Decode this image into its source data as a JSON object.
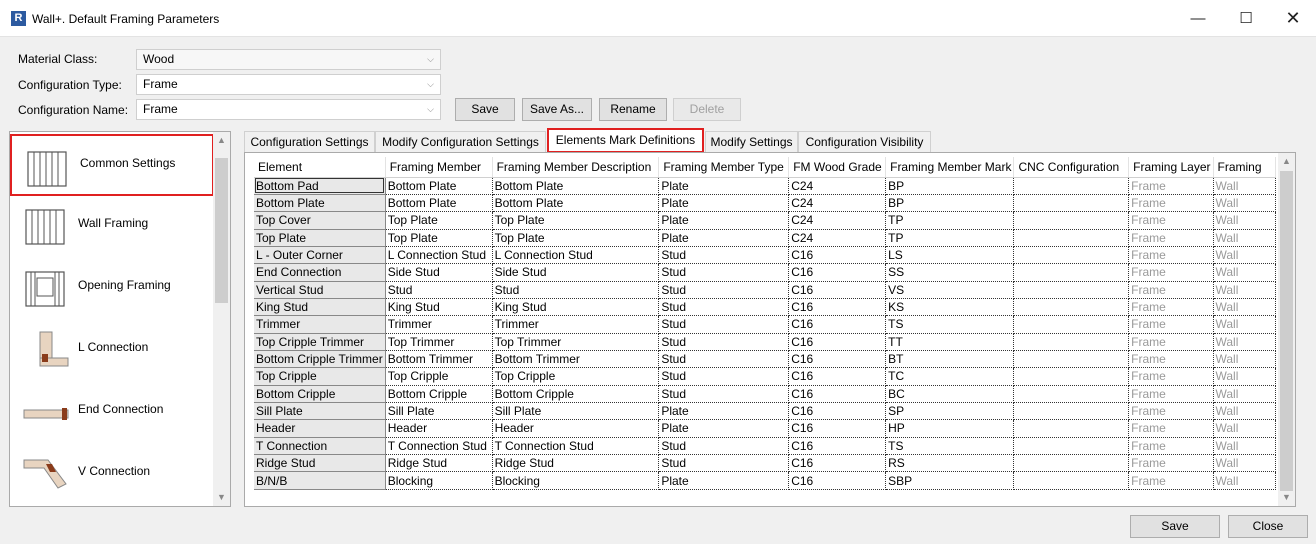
{
  "window": {
    "title": "Wall+. Default Framing Parameters",
    "app_icon": "R",
    "minimize": "—",
    "maximize": "☐",
    "close": "✕"
  },
  "form": {
    "material_class_label": "Material Class:",
    "material_class_value": "Wood",
    "config_type_label": "Configuration Type:",
    "config_type_value": "Frame",
    "config_name_label": "Configuration Name:",
    "config_name_value": "Frame",
    "save": "Save",
    "save_as": "Save As...",
    "rename": "Rename",
    "delete": "Delete"
  },
  "sidebar": {
    "items": [
      {
        "label": "Common Settings",
        "icon": "framing-wall-icon"
      },
      {
        "label": "Wall Framing",
        "icon": "wall-framing-icon"
      },
      {
        "label": "Opening Framing",
        "icon": "opening-framing-icon"
      },
      {
        "label": "L Connection",
        "icon": "l-connection-icon"
      },
      {
        "label": "End Connection",
        "icon": "end-connection-icon"
      },
      {
        "label": "V Connection",
        "icon": "v-connection-icon"
      }
    ]
  },
  "tabs": [
    "Configuration Settings",
    "Modify Configuration Settings",
    "Elements Mark Definitions",
    "Modify Settings",
    "Configuration Visibility"
  ],
  "table": {
    "columns": [
      "Element",
      "Framing Member",
      "Framing Member Description",
      "Framing Member Type",
      "FM Wood Grade",
      "Framing Member Mark",
      "CNC Configuration",
      "Framing Layer",
      "Framing"
    ],
    "rows": [
      [
        "Bottom Pad",
        "Bottom Plate",
        "Bottom Plate",
        "Plate",
        "C24",
        "BP",
        "",
        "Frame",
        "Wall"
      ],
      [
        "Bottom Plate",
        "Bottom Plate",
        "Bottom Plate",
        "Plate",
        "C24",
        "BP",
        "",
        "Frame",
        "Wall"
      ],
      [
        "Top Cover",
        "Top Plate",
        "Top Plate",
        "Plate",
        "C24",
        "TP",
        "",
        "Frame",
        "Wall"
      ],
      [
        "Top Plate",
        "Top Plate",
        "Top Plate",
        "Plate",
        "C24",
        "TP",
        "",
        "Frame",
        "Wall"
      ],
      [
        "L - Outer Corner",
        "L Connection Stud",
        "L Connection Stud",
        "Stud",
        "C16",
        "LS",
        "",
        "Frame",
        "Wall"
      ],
      [
        "End Connection",
        "Side Stud",
        "Side Stud",
        "Stud",
        "C16",
        "SS",
        "",
        "Frame",
        "Wall"
      ],
      [
        "Vertical Stud",
        "Stud",
        "Stud",
        "Stud",
        "C16",
        "VS",
        "",
        "Frame",
        "Wall"
      ],
      [
        "King Stud",
        "King Stud",
        "King Stud",
        "Stud",
        "C16",
        "KS",
        "",
        "Frame",
        "Wall"
      ],
      [
        "Trimmer",
        "Trimmer",
        "Trimmer",
        "Stud",
        "C16",
        "TS",
        "",
        "Frame",
        "Wall"
      ],
      [
        "Top Cripple Trimmer",
        "Top Trimmer",
        "Top Trimmer",
        "Stud",
        "C16",
        "TT",
        "",
        "Frame",
        "Wall"
      ],
      [
        "Bottom Cripple Trimmer",
        "Bottom Trimmer",
        "Bottom Trimmer",
        "Stud",
        "C16",
        "BT",
        "",
        "Frame",
        "Wall"
      ],
      [
        "Top Cripple",
        "Top Cripple",
        "Top Cripple",
        "Stud",
        "C16",
        "TC",
        "",
        "Frame",
        "Wall"
      ],
      [
        "Bottom Cripple",
        "Bottom Cripple",
        "Bottom Cripple",
        "Stud",
        "C16",
        "BC",
        "",
        "Frame",
        "Wall"
      ],
      [
        "Sill Plate",
        "Sill Plate",
        "Sill Plate",
        "Plate",
        "C16",
        "SP",
        "",
        "Frame",
        "Wall"
      ],
      [
        "Header",
        "Header",
        "Header",
        "Plate",
        "C16",
        "HP",
        "",
        "Frame",
        "Wall"
      ],
      [
        "T Connection",
        "T Connection Stud",
        "T Connection Stud",
        "Stud",
        "C16",
        "TS",
        "",
        "Frame",
        "Wall"
      ],
      [
        "Ridge Stud",
        "Ridge Stud",
        "Ridge Stud",
        "Stud",
        "C16",
        "RS",
        "",
        "Frame",
        "Wall"
      ],
      [
        "B/N/B",
        "Blocking",
        "Blocking",
        "Plate",
        "C16",
        "SBP",
        "",
        "Frame",
        "Wall"
      ]
    ]
  },
  "footer": {
    "save": "Save",
    "close": "Close"
  }
}
